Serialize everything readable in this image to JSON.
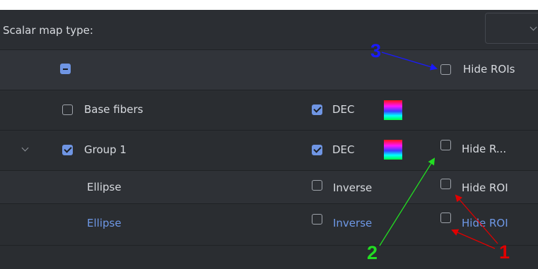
{
  "scalar_map": {
    "label": "Scalar map type:",
    "selected_value": ""
  },
  "header": {
    "hide_rois_label": "Hide ROIs"
  },
  "rows": {
    "base_fibers": {
      "label": "Base fibers",
      "checked": false,
      "dec_label": "DEC",
      "dec_checked": true
    },
    "group1": {
      "label": "Group 1",
      "checked": true,
      "dec_label": "DEC",
      "dec_checked": true,
      "hide_label": "Hide R..."
    },
    "ellipse1": {
      "label": "Ellipse",
      "inverse_label": "Inverse",
      "hide_label": "Hide ROI"
    },
    "ellipse2": {
      "label": "Ellipse",
      "inverse_label": "Inverse",
      "hide_label": "Hide ROI"
    }
  },
  "annotations": {
    "one": "1",
    "two": "2",
    "three": "3"
  },
  "colors": {
    "background": "#2a2d31",
    "accent": "#6f95e3",
    "annotation_red": "#e00000",
    "annotation_green": "#22dd22",
    "annotation_blue": "#1a1aff"
  }
}
